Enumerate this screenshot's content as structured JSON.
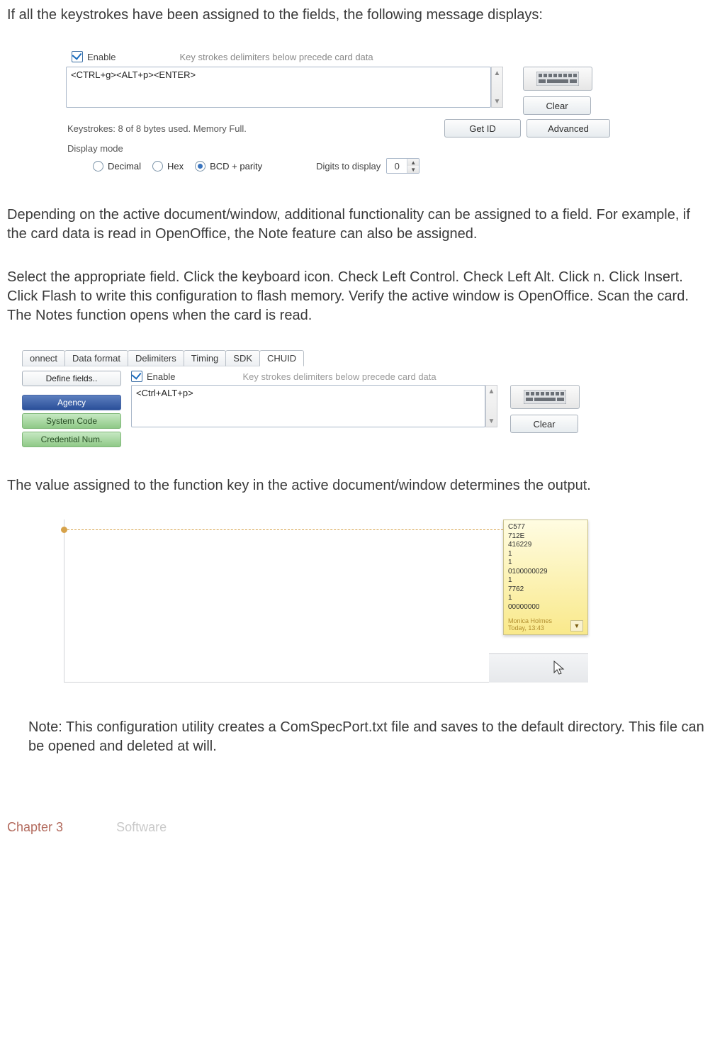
{
  "para1": "If all the keystrokes have been assigned to the fields, the following message displays:",
  "para2": "Depending on the active document/window, additional functionality can be assigned to a field. For example, if the card data is read in OpenOffice, the Note feature can also be assigned.",
  "para3": "Select the appropriate field. Click the keyboard icon. Check Left Control. Check Left Alt. Click n. Click Insert. Click Flash to write this configuration to flash memory. Verify the active window is OpenOffice.  Scan the card. The Notes function opens when the card is read.",
  "para4": "The value assigned to the function key in the active document/window determines the output.",
  "note": "Note: This configuration utility creates a ComSpecPort.txt file and saves to the default directory. This file can be opened and deleted at will.",
  "footer": {
    "chapter": "Chapter 3",
    "title": "Software"
  },
  "ss1": {
    "enable": "Enable",
    "hint": "Key strokes delimiters below precede card data",
    "textarea": "<CTRL+g><ALT+p><ENTER>",
    "clear": "Clear",
    "status": "Keystrokes: 8 of 8 bytes used. Memory Full.",
    "getid": "Get ID",
    "advanced": "Advanced",
    "display_mode": "Display mode",
    "radios": {
      "decimal": "Decimal",
      "hex": "Hex",
      "bcd": "BCD + parity"
    },
    "digits_label": "Digits to display",
    "digits_value": "0"
  },
  "ss2": {
    "tabs": [
      "onnect",
      "Data format",
      "Delimiters",
      "Timing",
      "SDK",
      "CHUID"
    ],
    "define": "Define fields..",
    "fields": {
      "agency": "Agency",
      "system": "System Code",
      "credential": "Credential Num."
    },
    "enable": "Enable",
    "hint": "Key strokes delimiters below precede card data",
    "textarea": "<Ctrl+ALT+p>",
    "clear": "Clear"
  },
  "ss3": {
    "lines": [
      "C577",
      "712E",
      "416229",
      "1",
      "1",
      "0100000029",
      "1",
      "7762",
      "1",
      "00000000"
    ],
    "author": "Monica Holmes",
    "time": "Today, 13:43"
  }
}
